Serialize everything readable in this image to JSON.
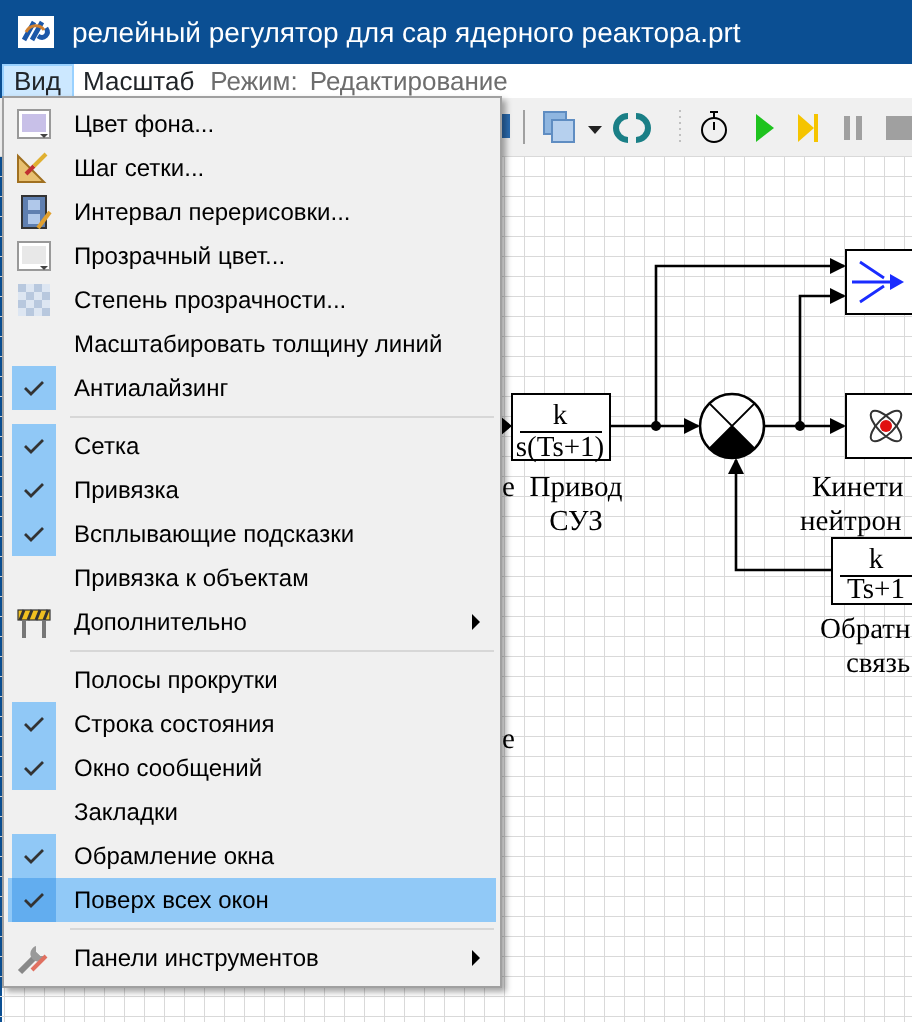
{
  "window": {
    "title": "релейный регулятор для сар ядерного реактора.prt"
  },
  "menubar": [
    {
      "label": "Вид",
      "selected": true
    },
    {
      "label": "Масштаб",
      "selected": false
    }
  ],
  "mode": {
    "label": "Режим:",
    "value": "Редактирование"
  },
  "menu": {
    "items": [
      {
        "kind": "item",
        "label": "Цвет фона...",
        "checked": false,
        "selected": false
      },
      {
        "kind": "item",
        "label": "Шаг сетки...",
        "checked": false,
        "selected": false
      },
      {
        "kind": "item",
        "label": "Интервал перерисовки...",
        "checked": false,
        "selected": false
      },
      {
        "kind": "item",
        "label": "Прозрачный цвет...",
        "checked": false,
        "selected": false
      },
      {
        "kind": "item",
        "label": "Степень прозрачности...",
        "checked": false,
        "selected": false
      },
      {
        "kind": "item",
        "label": "Масштабировать толщину линий",
        "checked": false,
        "selected": false
      },
      {
        "kind": "item",
        "label": "Антиалайзинг",
        "checked": true,
        "selected": false
      },
      {
        "kind": "separator"
      },
      {
        "kind": "item",
        "label": "Сетка",
        "checked": true,
        "selected": false
      },
      {
        "kind": "item",
        "label": "Привязка",
        "checked": true,
        "selected": false
      },
      {
        "kind": "item",
        "label": "Всплывающие подсказки",
        "checked": true,
        "selected": false
      },
      {
        "kind": "item",
        "label": "Привязка к объектам",
        "checked": false,
        "selected": false
      },
      {
        "kind": "item",
        "label": "Дополнительно",
        "checked": false,
        "selected": false,
        "submenu": true
      },
      {
        "kind": "separator"
      },
      {
        "kind": "item",
        "label": "Полосы прокрутки",
        "checked": false,
        "selected": false
      },
      {
        "kind": "item",
        "label": "Строка состояния",
        "checked": true,
        "selected": false
      },
      {
        "kind": "item",
        "label": "Окно сообщений",
        "checked": true,
        "selected": false
      },
      {
        "kind": "item",
        "label": "Закладки",
        "checked": false,
        "selected": false
      },
      {
        "kind": "item",
        "label": "Обрамление окна",
        "checked": true,
        "selected": false
      },
      {
        "kind": "item",
        "label": "Поверх всех окон",
        "checked": true,
        "selected": true
      },
      {
        "kind": "separator"
      },
      {
        "kind": "item",
        "label": "Панели инструментов",
        "checked": false,
        "selected": false,
        "submenu": true
      }
    ]
  },
  "diagram": {
    "blocks": [
      {
        "numerator": "k",
        "denominator": "s(Ts+1)",
        "caption": [
          "Привод",
          "СУЗ"
        ]
      },
      {
        "caption": [
          "Кинети",
          "нейтрон"
        ]
      },
      {
        "numerator": "k",
        "denominator": "Ts+1",
        "caption": [
          "Обратн",
          "связь"
        ]
      }
    ],
    "fragments": [
      "е",
      "е"
    ]
  }
}
